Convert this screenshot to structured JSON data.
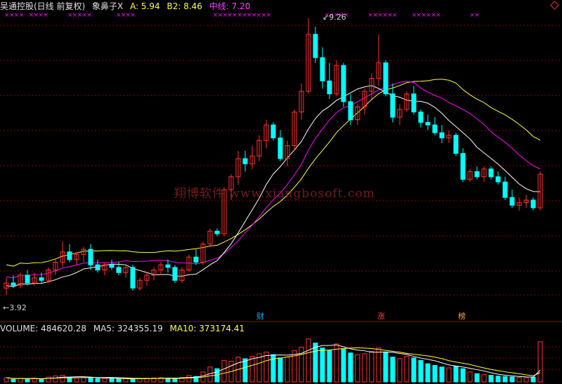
{
  "header": {
    "title": "吴通控股(日线 前复权)",
    "indicator_name": "象鼻子X",
    "a_label": "A: 5.94",
    "b2_label": "B2: 8.46",
    "mid_label": "中线: 7.20"
  },
  "volume_header": {
    "label": "VOLUME: 484620.28",
    "ma5": "MA5: 324355.19",
    "ma10": "MA10: 373174.41"
  },
  "price_labels": {
    "low": "3.92",
    "high": "9.26"
  },
  "events": [
    {
      "label": "财"
    },
    {
      "label": "涨"
    },
    {
      "label": "榜"
    }
  ],
  "watermark": "翔博软件 www.xiangbosoft.com",
  "colors": {
    "up": "#ff3030",
    "down": "#00ffff",
    "line_a": "#ffff40",
    "line_b2": "#ff00ff",
    "line_mid": "#ffffff",
    "grid": "#8b0000",
    "marker": "#ff00ff"
  },
  "chart_data": {
    "type": "candlestick",
    "price_range": [
      3.92,
      9.26
    ],
    "candles": [
      {
        "o": 4.05,
        "h": 4.25,
        "l": 3.92,
        "c": 4.15
      },
      {
        "o": 4.15,
        "h": 4.3,
        "l": 4.05,
        "c": 4.1
      },
      {
        "o": 4.1,
        "h": 4.35,
        "l": 4.05,
        "c": 4.3
      },
      {
        "o": 4.3,
        "h": 4.4,
        "l": 4.1,
        "c": 4.15
      },
      {
        "o": 4.15,
        "h": 4.35,
        "l": 4.1,
        "c": 4.25
      },
      {
        "o": 4.25,
        "h": 4.35,
        "l": 4.15,
        "c": 4.2
      },
      {
        "o": 4.2,
        "h": 4.45,
        "l": 4.15,
        "c": 4.4
      },
      {
        "o": 4.4,
        "h": 4.6,
        "l": 4.3,
        "c": 4.55
      },
      {
        "o": 4.55,
        "h": 4.95,
        "l": 4.45,
        "c": 4.75
      },
      {
        "o": 4.75,
        "h": 4.9,
        "l": 4.55,
        "c": 4.6
      },
      {
        "o": 4.6,
        "h": 4.75,
        "l": 4.5,
        "c": 4.7
      },
      {
        "o": 4.7,
        "h": 4.85,
        "l": 4.55,
        "c": 4.8
      },
      {
        "o": 4.8,
        "h": 4.9,
        "l": 4.4,
        "c": 4.5
      },
      {
        "o": 4.5,
        "h": 4.6,
        "l": 4.35,
        "c": 4.4
      },
      {
        "o": 4.4,
        "h": 4.55,
        "l": 4.3,
        "c": 4.5
      },
      {
        "o": 4.5,
        "h": 4.6,
        "l": 4.4,
        "c": 4.45
      },
      {
        "o": 4.45,
        "h": 4.55,
        "l": 4.3,
        "c": 4.35
      },
      {
        "o": 4.35,
        "h": 4.5,
        "l": 4.25,
        "c": 4.45
      },
      {
        "o": 4.45,
        "h": 4.5,
        "l": 4.0,
        "c": 4.05
      },
      {
        "o": 4.05,
        "h": 4.25,
        "l": 4.0,
        "c": 4.2
      },
      {
        "o": 4.2,
        "h": 4.35,
        "l": 4.1,
        "c": 4.3
      },
      {
        "o": 4.3,
        "h": 4.45,
        "l": 4.2,
        "c": 4.4
      },
      {
        "o": 4.4,
        "h": 4.55,
        "l": 4.3,
        "c": 4.5
      },
      {
        "o": 4.5,
        "h": 4.6,
        "l": 4.35,
        "c": 4.45
      },
      {
        "o": 4.45,
        "h": 4.5,
        "l": 4.15,
        "c": 4.2
      },
      {
        "o": 4.2,
        "h": 4.45,
        "l": 4.15,
        "c": 4.4
      },
      {
        "o": 4.4,
        "h": 4.7,
        "l": 4.35,
        "c": 4.65
      },
      {
        "o": 4.65,
        "h": 4.8,
        "l": 4.5,
        "c": 4.55
      },
      {
        "o": 4.55,
        "h": 4.95,
        "l": 4.5,
        "c": 4.9
      },
      {
        "o": 4.9,
        "h": 5.2,
        "l": 4.85,
        "c": 5.15
      },
      {
        "o": 5.15,
        "h": 5.2,
        "l": 5.05,
        "c": 5.1
      },
      {
        "o": 5.1,
        "h": 6.0,
        "l": 5.05,
        "c": 5.95
      },
      {
        "o": 5.95,
        "h": 6.25,
        "l": 5.75,
        "c": 6.2
      },
      {
        "o": 6.2,
        "h": 6.7,
        "l": 6.05,
        "c": 6.55
      },
      {
        "o": 6.55,
        "h": 6.7,
        "l": 6.3,
        "c": 6.45
      },
      {
        "o": 6.45,
        "h": 6.8,
        "l": 6.35,
        "c": 6.6
      },
      {
        "o": 6.6,
        "h": 7.0,
        "l": 6.5,
        "c": 6.9
      },
      {
        "o": 6.9,
        "h": 7.3,
        "l": 6.75,
        "c": 7.2
      },
      {
        "o": 7.2,
        "h": 7.25,
        "l": 6.9,
        "c": 6.95
      },
      {
        "o": 6.95,
        "h": 7.1,
        "l": 6.5,
        "c": 6.55
      },
      {
        "o": 6.55,
        "h": 6.9,
        "l": 6.4,
        "c": 6.8
      },
      {
        "o": 6.8,
        "h": 7.5,
        "l": 6.7,
        "c": 7.45
      },
      {
        "o": 7.45,
        "h": 8.0,
        "l": 7.3,
        "c": 7.85
      },
      {
        "o": 7.85,
        "h": 9.26,
        "l": 7.8,
        "c": 8.95
      },
      {
        "o": 8.95,
        "h": 9.1,
        "l": 8.4,
        "c": 8.5
      },
      {
        "o": 8.5,
        "h": 8.7,
        "l": 7.9,
        "c": 8.05
      },
      {
        "o": 8.05,
        "h": 8.4,
        "l": 7.7,
        "c": 7.8
      },
      {
        "o": 7.8,
        "h": 8.45,
        "l": 7.75,
        "c": 8.35
      },
      {
        "o": 8.35,
        "h": 8.4,
        "l": 7.55,
        "c": 7.65
      },
      {
        "o": 7.65,
        "h": 7.8,
        "l": 7.2,
        "c": 7.3
      },
      {
        "o": 7.3,
        "h": 7.6,
        "l": 7.2,
        "c": 7.55
      },
      {
        "o": 7.55,
        "h": 7.9,
        "l": 7.4,
        "c": 7.85
      },
      {
        "o": 7.85,
        "h": 8.2,
        "l": 7.7,
        "c": 8.1
      },
      {
        "o": 8.1,
        "h": 8.95,
        "l": 7.95,
        "c": 8.4
      },
      {
        "o": 8.4,
        "h": 8.45,
        "l": 7.75,
        "c": 7.8
      },
      {
        "o": 7.8,
        "h": 8.0,
        "l": 7.25,
        "c": 7.35
      },
      {
        "o": 7.35,
        "h": 7.6,
        "l": 7.2,
        "c": 7.5
      },
      {
        "o": 7.5,
        "h": 7.85,
        "l": 7.45,
        "c": 7.8
      },
      {
        "o": 7.8,
        "h": 7.95,
        "l": 7.4,
        "c": 7.45
      },
      {
        "o": 7.45,
        "h": 7.5,
        "l": 7.15,
        "c": 7.25
      },
      {
        "o": 7.25,
        "h": 7.4,
        "l": 7.1,
        "c": 7.2
      },
      {
        "o": 7.2,
        "h": 7.35,
        "l": 7.0,
        "c": 7.05
      },
      {
        "o": 7.05,
        "h": 7.2,
        "l": 6.85,
        "c": 6.95
      },
      {
        "o": 6.95,
        "h": 7.1,
        "l": 6.85,
        "c": 7.0
      },
      {
        "o": 7.0,
        "h": 7.05,
        "l": 6.6,
        "c": 6.65
      },
      {
        "o": 6.65,
        "h": 6.75,
        "l": 6.1,
        "c": 6.15
      },
      {
        "o": 6.15,
        "h": 6.35,
        "l": 6.1,
        "c": 6.3
      },
      {
        "o": 6.3,
        "h": 6.4,
        "l": 6.15,
        "c": 6.2
      },
      {
        "o": 6.2,
        "h": 6.4,
        "l": 6.1,
        "c": 6.35
      },
      {
        "o": 6.35,
        "h": 6.4,
        "l": 6.15,
        "c": 6.2
      },
      {
        "o": 6.2,
        "h": 6.3,
        "l": 6.05,
        "c": 6.1
      },
      {
        "o": 6.1,
        "h": 6.2,
        "l": 5.75,
        "c": 5.8
      },
      {
        "o": 5.8,
        "h": 5.95,
        "l": 5.6,
        "c": 5.65
      },
      {
        "o": 5.65,
        "h": 5.8,
        "l": 5.55,
        "c": 5.7
      },
      {
        "o": 5.7,
        "h": 5.85,
        "l": 5.6,
        "c": 5.75
      },
      {
        "o": 5.75,
        "h": 5.8,
        "l": 5.55,
        "c": 5.6
      },
      {
        "o": 5.6,
        "h": 6.3,
        "l": 5.55,
        "c": 6.25
      }
    ],
    "volumes": [
      52000,
      31000,
      42000,
      36000,
      45000,
      30000,
      58000,
      72000,
      80000,
      54000,
      48000,
      60000,
      50000,
      40000,
      42000,
      38000,
      36000,
      41000,
      35000,
      39000,
      44000,
      48000,
      52000,
      45000,
      40000,
      55000,
      78000,
      66000,
      120000,
      180000,
      160000,
      260000,
      250000,
      300000,
      280000,
      310000,
      340000,
      360000,
      330000,
      290000,
      300000,
      380000,
      420000,
      520000,
      470000,
      410000,
      380000,
      460000,
      400000,
      350000,
      330000,
      340000,
      370000,
      410000,
      360000,
      300000,
      280000,
      310000,
      290000,
      260000,
      220000,
      200000,
      180000,
      170000,
      190000,
      160000,
      120000,
      100000,
      90000,
      80000,
      70000,
      65000,
      60000,
      55000,
      52000,
      58000,
      484620
    ]
  }
}
